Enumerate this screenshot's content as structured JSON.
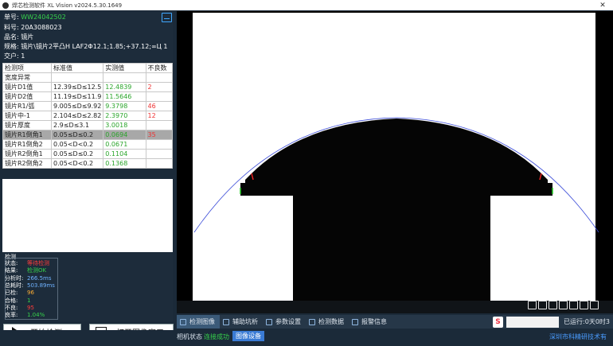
{
  "window": {
    "title": "焊芯检测软件 XL Vision v2024.5.30.1649",
    "close_label": "✕"
  },
  "info": {
    "order_label": "单号:",
    "order_value": "WW24042502",
    "material_label": "料号:",
    "material_value": "20A3088023",
    "name_label": "品名:",
    "name_value": "镜片",
    "spec_label": "规格:",
    "spec_value": "镜片\\镜片2平凸H LAF2Φ12.1;1.85;+37.12;∞Ц 1",
    "client_label": "交户:",
    "client_value": "1"
  },
  "table": {
    "headers": [
      "检测项",
      "标准值",
      "实测值",
      "不良数"
    ],
    "group_row": "宽度异常",
    "rows": [
      {
        "item": "镜片D1值",
        "std": "12.39≤D≤12.5",
        "val": "12.4839",
        "cnt": "2",
        "selected": false
      },
      {
        "item": "镜片D2值",
        "std": "11.19≤D≤11.9",
        "val": "11.5646",
        "cnt": "",
        "selected": false
      },
      {
        "item": "镜片R1/弧",
        "std": "9.005≤D≤9.92",
        "val": "9.3798",
        "cnt": "46",
        "selected": false
      },
      {
        "item": "镜片中-1",
        "std": "2.104≤D≤2.82",
        "val": "2.3970",
        "cnt": "12",
        "selected": false
      },
      {
        "item": "镜片厚度",
        "std": "2.9≤D≤3.1",
        "val": "3.0018",
        "cnt": "",
        "selected": false
      },
      {
        "item": "镜片R1倒角1",
        "std": "0.05≤D≤0.2",
        "val": "0.0694",
        "cnt": "35",
        "selected": true
      },
      {
        "item": "镜片R1倒角2",
        "std": "0.05<D<0.2",
        "val": "0.0671",
        "cnt": "",
        "selected": false
      },
      {
        "item": "镜片R2倒角1",
        "std": "0.05≤D≤0.2",
        "val": "0.1104",
        "cnt": "",
        "selected": false
      },
      {
        "item": "镜片R2倒角2",
        "std": "0.05<D<0.2",
        "val": "0.1368",
        "cnt": "",
        "selected": false
      }
    ]
  },
  "stats": {
    "header": "检测",
    "rows": [
      {
        "label": "状态:",
        "value": "等待检测",
        "color": "#ff3b3b"
      },
      {
        "label": "结果:",
        "value": "检测OK",
        "color": "#36d24b"
      },
      {
        "label": "分析时:",
        "value": "266.5ms",
        "color": "#6fb2ff"
      },
      {
        "label": "总耗时:",
        "value": "503.89ms",
        "color": "#6fb2ff"
      },
      {
        "label": "已检:",
        "value": "96",
        "color": "#ffae33"
      },
      {
        "label": "合格:",
        "value": "1",
        "color": "#36d24b"
      },
      {
        "label": "不良:",
        "value": "95",
        "color": "#ff3b3b"
      },
      {
        "label": "良率:",
        "value": "1.04%",
        "color": "#36d24b"
      }
    ]
  },
  "buttons": {
    "start_label": "开始检测",
    "open_image_label": "打开图像窗口"
  },
  "tabs": [
    {
      "label": "检测图像",
      "active": true
    },
    {
      "label": "辅助坑析",
      "active": false
    },
    {
      "label": "参数设置",
      "active": false
    },
    {
      "label": "检测数据",
      "active": false
    },
    {
      "label": "报警信息",
      "active": false
    }
  ],
  "tabs_right": {
    "ime_glyph": "S",
    "time_text": "已运行:0天0时3"
  },
  "status": {
    "camera_label": "相机状态",
    "camera_value": "连接成功",
    "button_label": "图像设备",
    "company": "深圳市科精研技术有"
  },
  "colors": {
    "accent": "#3a7bd5",
    "ok": "#36d24b",
    "ng": "#ff3b3b"
  }
}
